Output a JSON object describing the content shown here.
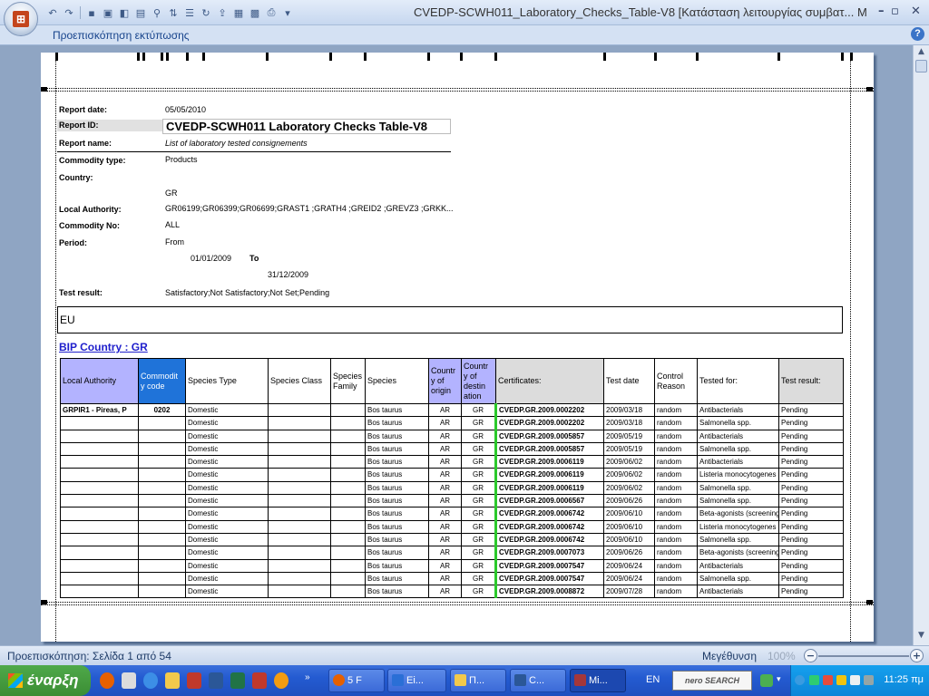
{
  "window": {
    "title": "CVEDP-SCWH011_Laboratory_Checks_Table-V8  [Κατάσταση λειτουργίας συμβατ...",
    "title_suffix": "Μ",
    "controls": {
      "minimize": "–",
      "maximize": "▫",
      "close": "✕"
    }
  },
  "ribbon": {
    "tab": "Προεπισκόπηση εκτύπωσης",
    "help": "?"
  },
  "report": {
    "labels": {
      "date": "Report date:",
      "id": "Report ID:",
      "name": "Report name:",
      "commodity_type": "Commodity type:",
      "country": "Country:",
      "local_authority": "Local Authority:",
      "commodity_no": "Commodity No:",
      "period": "Period:",
      "test_result": "Test result:"
    },
    "date": "05/05/2010",
    "id": "CVEDP-SCWH011 Laboratory Checks Table-V8",
    "name": "List of laboratory tested consignements",
    "commodity_type": "Products",
    "country": "GR",
    "local_authority": "GR06199;GR06399;GR06699;GRAST1 ;GRATH4 ;GREID2 ;GREVZ3 ;GRKK...",
    "commodity_no": "ALL",
    "period_from_label": "From",
    "period_from": "01/01/2009",
    "period_to_label": "To",
    "period_to": "31/12/2009",
    "test_result": "Satisfactory;Not Satisfactory;Not Set;Pending",
    "eu": "EU",
    "bip_country": "BIP Country : GR"
  },
  "table": {
    "headers": [
      "Local Authority",
      "Commodit y code",
      "Species Type",
      "Species Class",
      "Species Family",
      "Species",
      "Countr y of origin",
      "Countr y of destin ation",
      "Certificates:",
      "Test date",
      "Control Reason",
      "Tested for:",
      "Test result:"
    ],
    "rows": [
      [
        "GRPIR1  - Pireas, P",
        "0202",
        "Domestic",
        "",
        "",
        "Bos taurus",
        "AR",
        "GR",
        "CVEDP.GR.2009.0002202",
        "2009/03/18",
        "random",
        "Antibacterials",
        "Pending"
      ],
      [
        "",
        "",
        "Domestic",
        "",
        "",
        "Bos taurus",
        "AR",
        "GR",
        "CVEDP.GR.2009.0002202",
        "2009/03/18",
        "random",
        "Salmonella spp.",
        "Pending"
      ],
      [
        "",
        "",
        "Domestic",
        "",
        "",
        "Bos taurus",
        "AR",
        "GR",
        "CVEDP.GR.2009.0005857",
        "2009/05/19",
        "random",
        "Antibacterials",
        "Pending"
      ],
      [
        "",
        "",
        "Domestic",
        "",
        "",
        "Bos taurus",
        "AR",
        "GR",
        "CVEDP.GR.2009.0005857",
        "2009/05/19",
        "random",
        "Salmonella spp.",
        "Pending"
      ],
      [
        "",
        "",
        "Domestic",
        "",
        "",
        "Bos taurus",
        "AR",
        "GR",
        "CVEDP.GR.2009.0006119",
        "2009/06/02",
        "random",
        "Antibacterials",
        "Pending"
      ],
      [
        "",
        "",
        "Domestic",
        "",
        "",
        "Bos taurus",
        "AR",
        "GR",
        "CVEDP.GR.2009.0006119",
        "2009/06/02",
        "random",
        "Listeria monocytogenes",
        "Pending"
      ],
      [
        "",
        "",
        "Domestic",
        "",
        "",
        "Bos taurus",
        "AR",
        "GR",
        "CVEDP.GR.2009.0006119",
        "2009/06/02",
        "random",
        "Salmonella spp.",
        "Pending"
      ],
      [
        "",
        "",
        "Domestic",
        "",
        "",
        "Bos taurus",
        "AR",
        "GR",
        "CVEDP.GR.2009.0006567",
        "2009/06/26",
        "random",
        "Salmonella spp.",
        "Pending"
      ],
      [
        "",
        "",
        "Domestic",
        "",
        "",
        "Bos taurus",
        "AR",
        "GR",
        "CVEDP.GR.2009.0006742",
        "2009/06/10",
        "random",
        "Beta-agonists (screening)",
        "Pending"
      ],
      [
        "",
        "",
        "Domestic",
        "",
        "",
        "Bos taurus",
        "AR",
        "GR",
        "CVEDP.GR.2009.0006742",
        "2009/06/10",
        "random",
        "Listeria monocytogenes",
        "Pending"
      ],
      [
        "",
        "",
        "Domestic",
        "",
        "",
        "Bos taurus",
        "AR",
        "GR",
        "CVEDP.GR.2009.0006742",
        "2009/06/10",
        "random",
        "Salmonella spp.",
        "Pending"
      ],
      [
        "",
        "",
        "Domestic",
        "",
        "",
        "Bos taurus",
        "AR",
        "GR",
        "CVEDP.GR.2009.0007073",
        "2009/06/26",
        "random",
        "Beta-agonists (screening)",
        "Pending"
      ],
      [
        "",
        "",
        "Domestic",
        "",
        "",
        "Bos taurus",
        "AR",
        "GR",
        "CVEDP.GR.2009.0007547",
        "2009/06/24",
        "random",
        "Antibacterials",
        "Pending"
      ],
      [
        "",
        "",
        "Domestic",
        "",
        "",
        "Bos taurus",
        "AR",
        "GR",
        "CVEDP.GR.2009.0007547",
        "2009/06/24",
        "random",
        "Salmonella spp.",
        "Pending"
      ],
      [
        "",
        "",
        "Domestic",
        "",
        "",
        "Bos taurus",
        "AR",
        "GR",
        "CVEDP.GR.2009.0008872",
        "2009/07/28",
        "random",
        "Antibacterials",
        "Pending"
      ]
    ]
  },
  "statusbar": {
    "page_info": "Προεπισκόπηση: Σελίδα 1 από 54",
    "zoom_label": "Μεγέθυνση",
    "zoom_value": "100%",
    "zoom_minus": "−",
    "zoom_plus": "+"
  },
  "taskbar": {
    "start": "έναρξη",
    "tasks": [
      {
        "label": "5 F",
        "icon": "firefox-icon",
        "color": "#e66000"
      },
      {
        "label": "Ei...",
        "icon": "outlook-icon",
        "color": "#2a6fd6"
      },
      {
        "label": "Π...",
        "icon": "folder-icon",
        "color": "#f2c94c"
      },
      {
        "label": "C...",
        "icon": "word-icon",
        "color": "#2b5797"
      },
      {
        "label": "Mi...",
        "icon": "access-icon",
        "color": "#a4373a"
      }
    ],
    "language": "EN",
    "search_logo": "nero SEARCH",
    "clock": "11:25 πμ"
  }
}
